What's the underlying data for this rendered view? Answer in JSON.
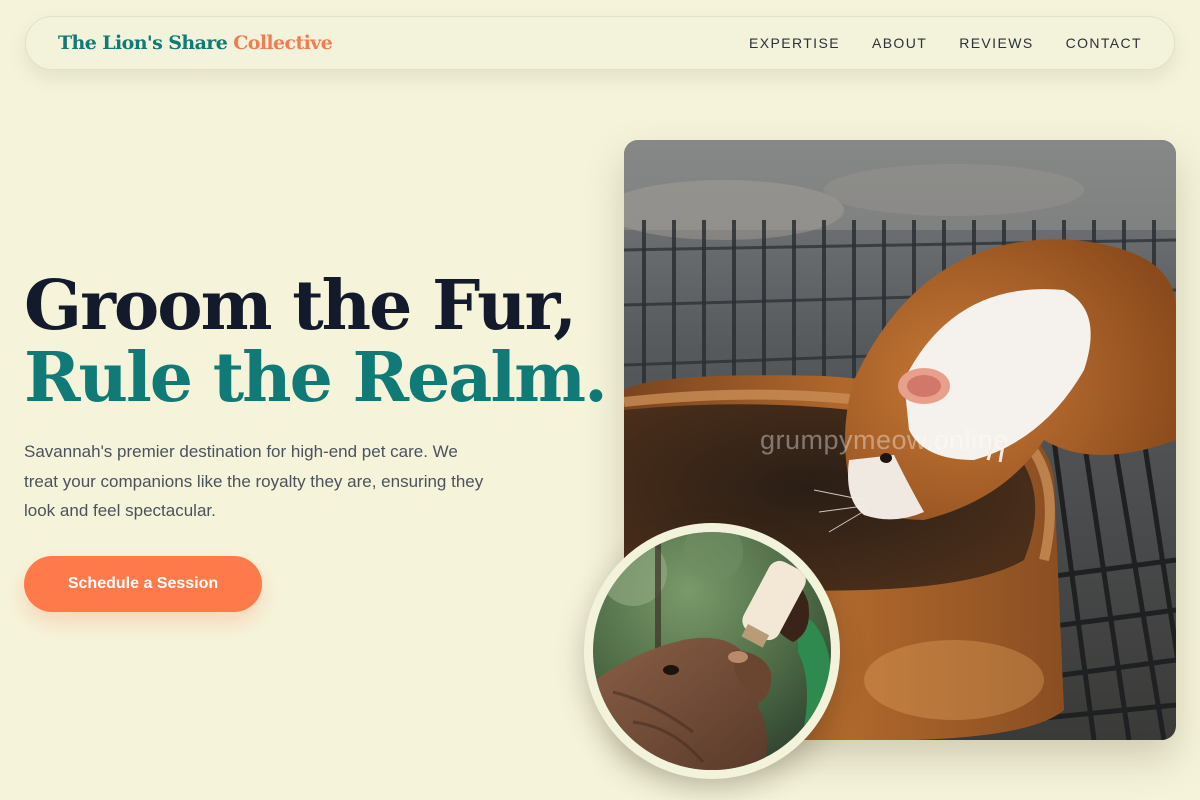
{
  "brand": {
    "part1": "The Lion's Share",
    "part2": "Collective"
  },
  "nav": {
    "items": [
      {
        "label": "EXPERTISE"
      },
      {
        "label": "ABOUT"
      },
      {
        "label": "REVIEWS"
      },
      {
        "label": "CONTACT"
      }
    ]
  },
  "hero": {
    "headline_line1": "Groom the Fur,",
    "headline_line2": "Rule the Realm.",
    "lead": "Savannah's premier destination for high-end pet care. We treat your companions like the royalty they are, ensuring they look and feel spectacular.",
    "cta_label": "Schedule a Session"
  },
  "images": {
    "main": {
      "name": "guinea-pig-photo"
    },
    "inset": {
      "name": "baby-elephant-bottle-photo"
    },
    "watermark": "grumpymeow.online"
  },
  "colors": {
    "background": "#f5f4db",
    "teal": "#0f7a76",
    "coral": "#ff7a4a",
    "navy": "#131a2c"
  }
}
